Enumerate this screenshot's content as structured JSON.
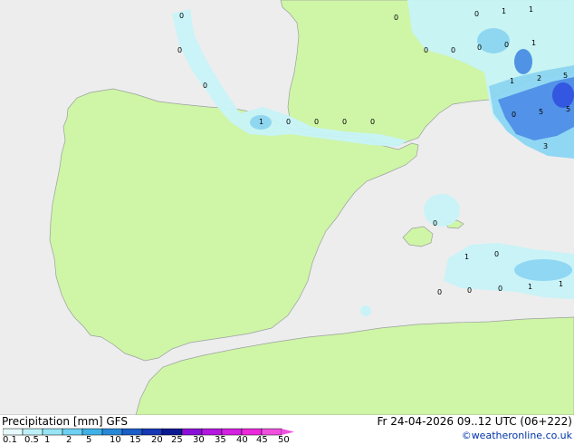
{
  "title": "Precipitation [mm]  GFS",
  "timestamp": "Fr 24-04-2026 09..12 UTC (06+222)",
  "credit": "©weatheronline.co.uk",
  "legend": {
    "ticks": [
      "0.1",
      "0.5",
      "1",
      "2",
      "5",
      "10",
      "15",
      "20",
      "25",
      "30",
      "35",
      "40",
      "45",
      "50"
    ],
    "colors": [
      "#e6fafd",
      "#bef0f8",
      "#96e4f4",
      "#6cd0f0",
      "#3eb2e8",
      "#2888d8",
      "#1c5ec8",
      "#1638b4",
      "#0c1890",
      "#8a10d8",
      "#b418e0",
      "#d420e0",
      "#ec28dc",
      "#f050e0"
    ]
  },
  "colors": {
    "sea": "#ededed",
    "land": "#cff5a6",
    "precip_light": "#c8f4f8",
    "precip_mid": "#8cd6f4",
    "precip_heavy": "#4a8ee8",
    "precip_max": "#2a4fe0"
  },
  "map_labels": [
    {
      "text": "0",
      "name": "label-biscay-1"
    },
    {
      "text": "0",
      "name": "label-biscay-2"
    },
    {
      "text": "0",
      "name": "label-biscay-3"
    },
    {
      "text": "1",
      "name": "label-pyrenees-1"
    },
    {
      "text": "0",
      "name": "label-pyrenees-2"
    },
    {
      "text": "0",
      "name": "label-pyrenees-3"
    },
    {
      "text": "0",
      "name": "label-pyrenees-4"
    },
    {
      "text": "0",
      "name": "label-pyrenees-5"
    },
    {
      "text": "0",
      "name": "label-france-1"
    },
    {
      "text": "0",
      "name": "label-france-2"
    },
    {
      "text": "0",
      "name": "label-france-3"
    },
    {
      "text": "0",
      "name": "label-alps-1"
    },
    {
      "text": "1",
      "name": "label-alps-2"
    },
    {
      "text": "1",
      "name": "label-alps-3"
    },
    {
      "text": "0",
      "name": "label-alps-4"
    },
    {
      "text": "0",
      "name": "label-alps-5"
    },
    {
      "text": "1",
      "name": "label-alps-6"
    },
    {
      "text": "1",
      "name": "label-ligurian-1"
    },
    {
      "text": "2",
      "name": "label-ligurian-2"
    },
    {
      "text": "5",
      "name": "label-ligurian-3"
    },
    {
      "text": "0",
      "name": "label-ligurian-4"
    },
    {
      "text": "5",
      "name": "label-ligurian-5"
    },
    {
      "text": "5",
      "name": "label-ligurian-6"
    },
    {
      "text": "3",
      "name": "label-ligurian-7"
    },
    {
      "text": "0",
      "name": "label-balearic-1"
    },
    {
      "text": "1",
      "name": "label-balearic-2"
    },
    {
      "text": "0",
      "name": "label-balearic-3"
    },
    {
      "text": "0",
      "name": "label-med-1"
    },
    {
      "text": "0",
      "name": "label-med-2"
    },
    {
      "text": "0",
      "name": "label-med-3"
    },
    {
      "text": "1",
      "name": "label-med-4"
    },
    {
      "text": "1",
      "name": "label-med-5"
    }
  ]
}
